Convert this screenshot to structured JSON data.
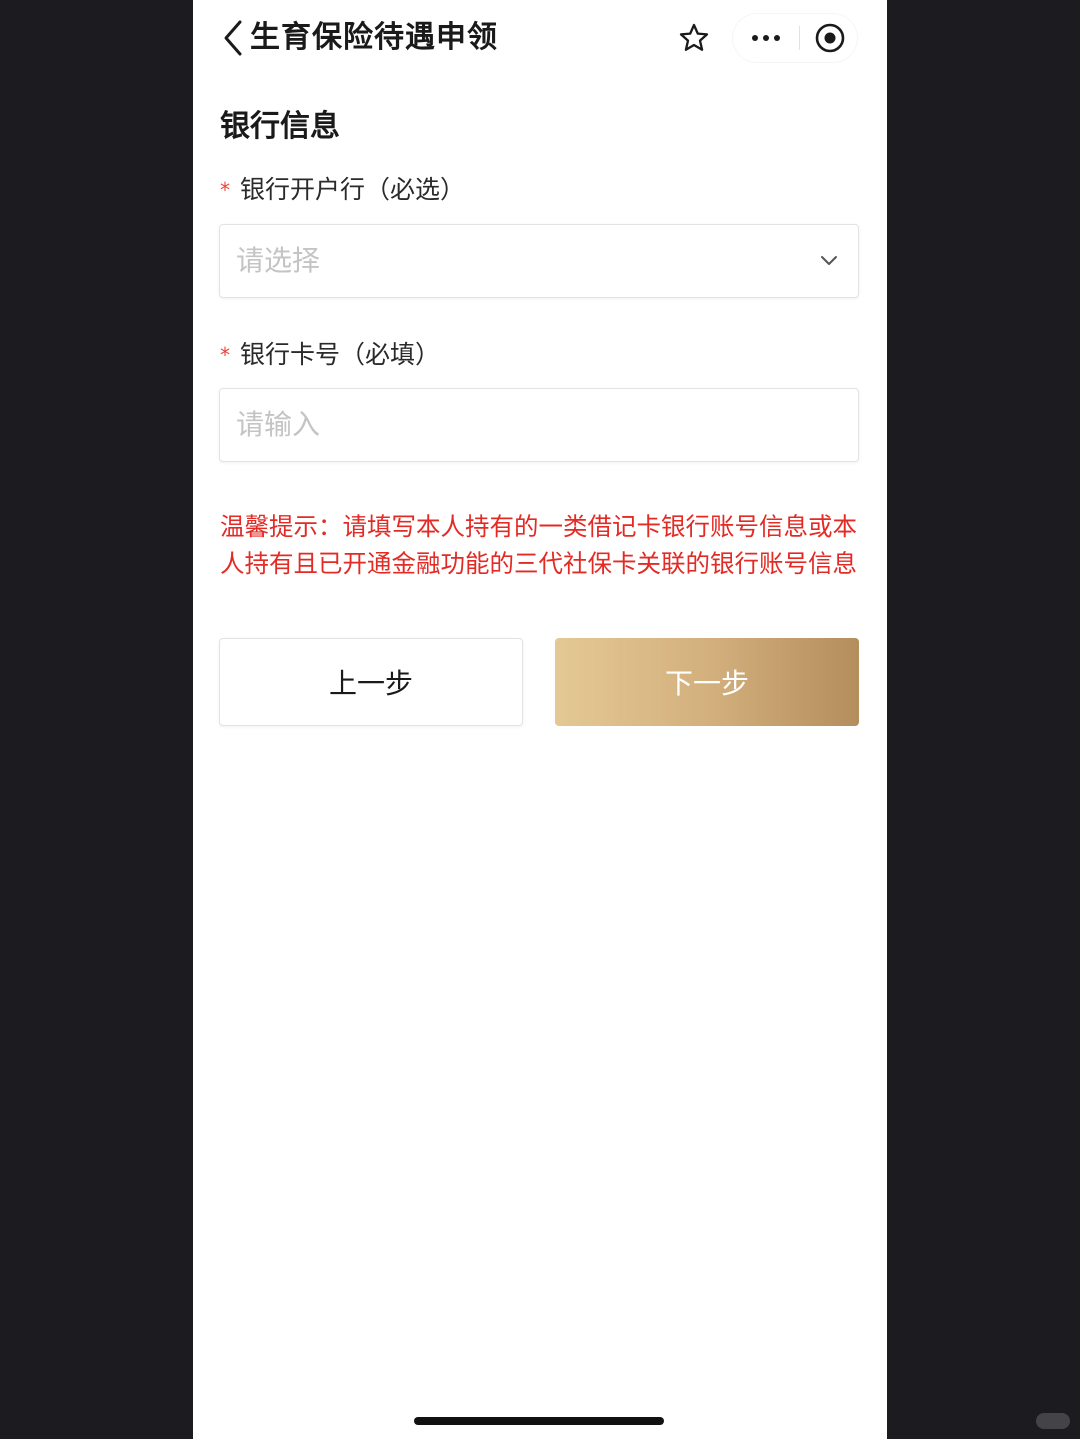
{
  "nav": {
    "title": "生育保险待遇申领",
    "back_icon": "chevron-left-icon",
    "favorite_icon": "star-outline-icon",
    "more_icon": "more-dots-icon",
    "close_icon": "target-circle-icon"
  },
  "section": {
    "title": "银行信息"
  },
  "form": {
    "bank": {
      "required_mark": "*",
      "label": "银行开户行（必选）",
      "placeholder": "请选择"
    },
    "card": {
      "required_mark": "*",
      "label": "银行卡号（必填）",
      "placeholder": "请输入"
    }
  },
  "tip": "温馨提示：请填写本人持有的一类借记卡银行账号信息或本人持有且已开通金融功能的三代社保卡关联的银行账号信息",
  "buttons": {
    "prev": "上一步",
    "next": "下一步"
  },
  "colors": {
    "required": "#e8453c",
    "tip": "#e32b26",
    "next_gradient_start": "#e4c994",
    "next_gradient_end": "#b48e5d",
    "background": "#1b1b20"
  }
}
